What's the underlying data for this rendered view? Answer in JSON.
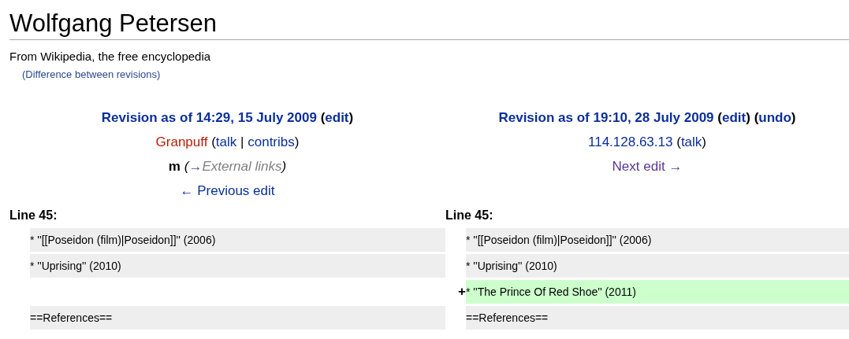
{
  "page": {
    "title": "Wolfgang Petersen",
    "tagline": "From Wikipedia, the free encyclopedia",
    "subtitle": "(Difference between revisions)"
  },
  "revisions": [
    {
      "lines": [
        [
          {
            "kind": "heading_link",
            "text": "Revision as of 14:29, 15 July 2009"
          },
          {
            "kind": "bold_plain",
            "text": "("
          },
          {
            "kind": "heading_link",
            "text": "edit"
          },
          {
            "kind": "bold_plain",
            "text": ")"
          }
        ],
        [
          {
            "kind": "missing_link",
            "text": "Granpuff"
          },
          {
            "kind": "plain",
            "text": "("
          },
          {
            "kind": "link",
            "text": "talk"
          },
          {
            "kind": "plain",
            "text": "|"
          },
          {
            "kind": "link",
            "text": "contribs"
          },
          {
            "kind": "plain",
            "text": ")"
          }
        ],
        [
          {
            "kind": "minor_flag",
            "text": "m"
          },
          {
            "kind": "italic_plain",
            "text": "("
          },
          {
            "kind": "visited_link",
            "text": "→"
          },
          {
            "kind": "summary",
            "text": "External links"
          },
          {
            "kind": "italic_plain",
            "text": ")"
          }
        ],
        [
          {
            "kind": "link",
            "text": "← Previous edit"
          }
        ]
      ]
    },
    {
      "lines": [
        [
          {
            "kind": "heading_link",
            "text": "Revision as of 19:10, 28 July 2009"
          },
          {
            "kind": "bold_plain",
            "text": "("
          },
          {
            "kind": "heading_link",
            "text": "edit"
          },
          {
            "kind": "bold_plain",
            "text": ")"
          },
          {
            "kind": "bold_plain",
            "text": "("
          },
          {
            "kind": "heading_link",
            "text": "undo"
          },
          {
            "kind": "bold_plain",
            "text": ")"
          }
        ],
        [
          {
            "kind": "link",
            "text": "114.128.63.13"
          },
          {
            "kind": "plain",
            "text": "("
          },
          {
            "kind": "link",
            "text": "talk"
          },
          {
            "kind": "plain",
            "text": ")"
          }
        ],
        [
          {
            "kind": "visited_link",
            "text": "Next edit →"
          }
        ]
      ]
    }
  ],
  "diff": {
    "line_labels": [
      "Line 45:",
      "Line 45:"
    ],
    "rows": [
      {
        "left": {
          "kind": "context",
          "text": "* ''[[Poseidon (film)|Poseidon]]'' (2006)"
        },
        "right": {
          "kind": "context",
          "text": "* ''[[Poseidon (film)|Poseidon]]'' (2006)"
        }
      },
      {
        "left": {
          "kind": "context",
          "text": "* ''Uprising'' (2010)"
        },
        "right": {
          "kind": "context",
          "text": "* ''Uprising'' (2010)"
        }
      },
      {
        "left": {
          "kind": "empty"
        },
        "right": {
          "kind": "added",
          "marker": "+",
          "text": "* ''The Prince Of Red Shoe'' (2011)"
        }
      },
      {
        "left": {
          "kind": "context",
          "text": "==References=="
        },
        "right": {
          "kind": "context",
          "text": "==References=="
        }
      }
    ]
  }
}
